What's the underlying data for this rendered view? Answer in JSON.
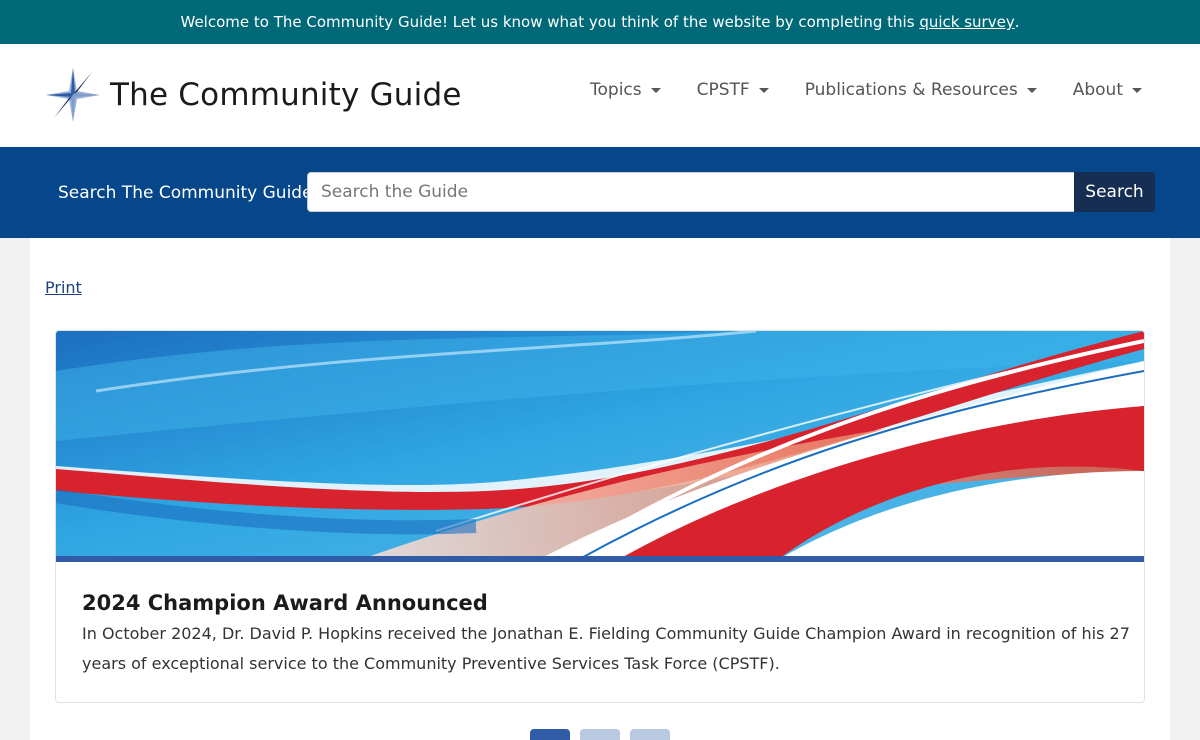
{
  "banner": {
    "text": "Welcome to The Community Guide! Let us know what you think of the website by completing this ",
    "link": "quick survey",
    "suffix": "."
  },
  "header": {
    "logo_icon": "compass-star-icon",
    "title": "The Community Guide",
    "nav": [
      {
        "label": "Topics"
      },
      {
        "label": "CPSTF"
      },
      {
        "label": "Publications & Resources"
      },
      {
        "label": "About"
      }
    ]
  },
  "search": {
    "label": "Search The Community Guide",
    "placeholder": "Search the Guide",
    "button": "Search"
  },
  "main": {
    "print_label": "Print",
    "card": {
      "title": "2024 Champion Award Announced",
      "text": "In October 2024, Dr. David P. Hopkins received the Jonathan E. Fielding Community Guide Champion Award in recognition of his 27 years of exceptional service to the Community Preventive Services Task Force (CPSTF)."
    }
  },
  "carousel": {
    "active_index": 0,
    "total": 3
  },
  "colors": {
    "banner": "#006978",
    "search_bar": "#05478a",
    "search_button": "#162e51",
    "accent": "#2f5ba7"
  }
}
